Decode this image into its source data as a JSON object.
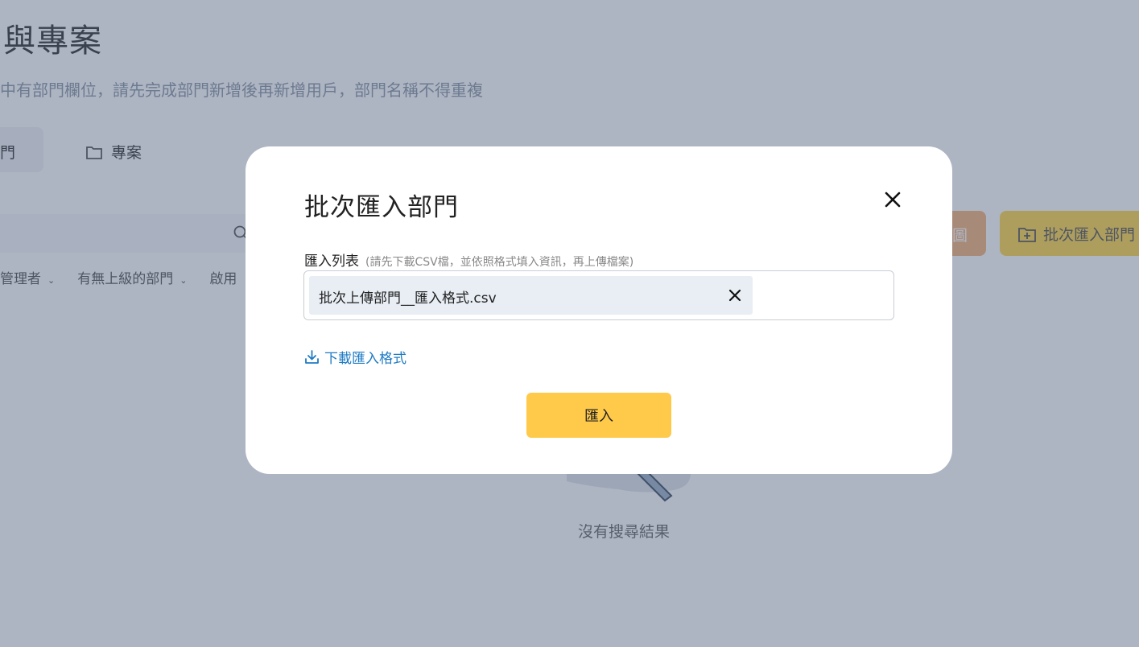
{
  "background": {
    "page_title": "與專案",
    "page_subtitle": "中有部門欄位，請先完成部門新增後再新增用戶，部門名稱不得重複",
    "tabs": {
      "active_label": "門",
      "project_label": "專案"
    },
    "buttons": {
      "orange_label": "圖",
      "batch_import_label": "批次匯入部門"
    },
    "filters": [
      "管理者",
      "有無上級的部門",
      "啟用"
    ],
    "empty_text": "沒有搜尋結果"
  },
  "modal": {
    "title": "批次匯入部門",
    "field_label": "匯入列表",
    "field_hint": "(請先下載CSV檔，並依照格式填入資訊，再上傳檔案)",
    "file_name": "批次上傳部門__匯入格式.csv",
    "download_label": "下載匯入格式",
    "import_button": "匯入"
  },
  "colors": {
    "overlay": "#465674",
    "accent_yellow": "#ffc94a",
    "link_blue": "#1e7bc4",
    "chip_bg": "#e8eef4"
  },
  "icons": [
    "close-icon",
    "folder-icon",
    "folder-add-icon",
    "search-icon",
    "download-icon",
    "chevron-down-icon"
  ]
}
